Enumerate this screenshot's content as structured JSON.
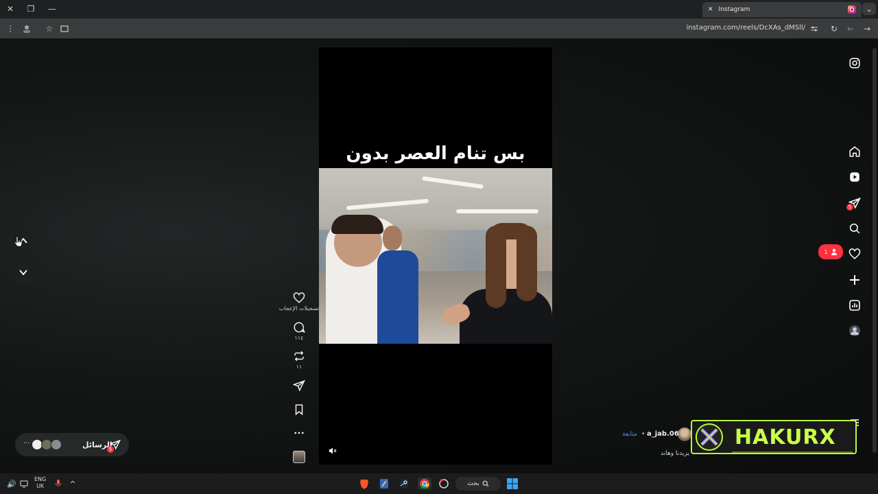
{
  "browser": {
    "tab_title": "Instagram",
    "url": "instagram.com/reels/DcXAs_dMSll/"
  },
  "reel": {
    "caption_overlay": "بس تنام العصر بدون مروحه",
    "actions": {
      "likes_label": "تسجيلات الإعجاب",
      "comments_count": "١١٤",
      "reposts_count": "١١"
    },
    "author": {
      "username": "a_jab.06",
      "separator": "•",
      "follow_label": "متابعة",
      "caption": "يزيدنا وهاند"
    }
  },
  "messages": {
    "label": "الرسائل",
    "badge": "5"
  },
  "sidebar": {
    "messages_badge": "5",
    "notification_badge": "1"
  },
  "watermark": {
    "text": "HAKURX"
  },
  "taskbar": {
    "lang_top": "ENG",
    "lang_bottom": "UK",
    "search_label": "بحث"
  },
  "colors": {
    "accent_watermark": "#c9ff4a",
    "badge": "#ff3040",
    "follow_link": "#4a8df8"
  }
}
